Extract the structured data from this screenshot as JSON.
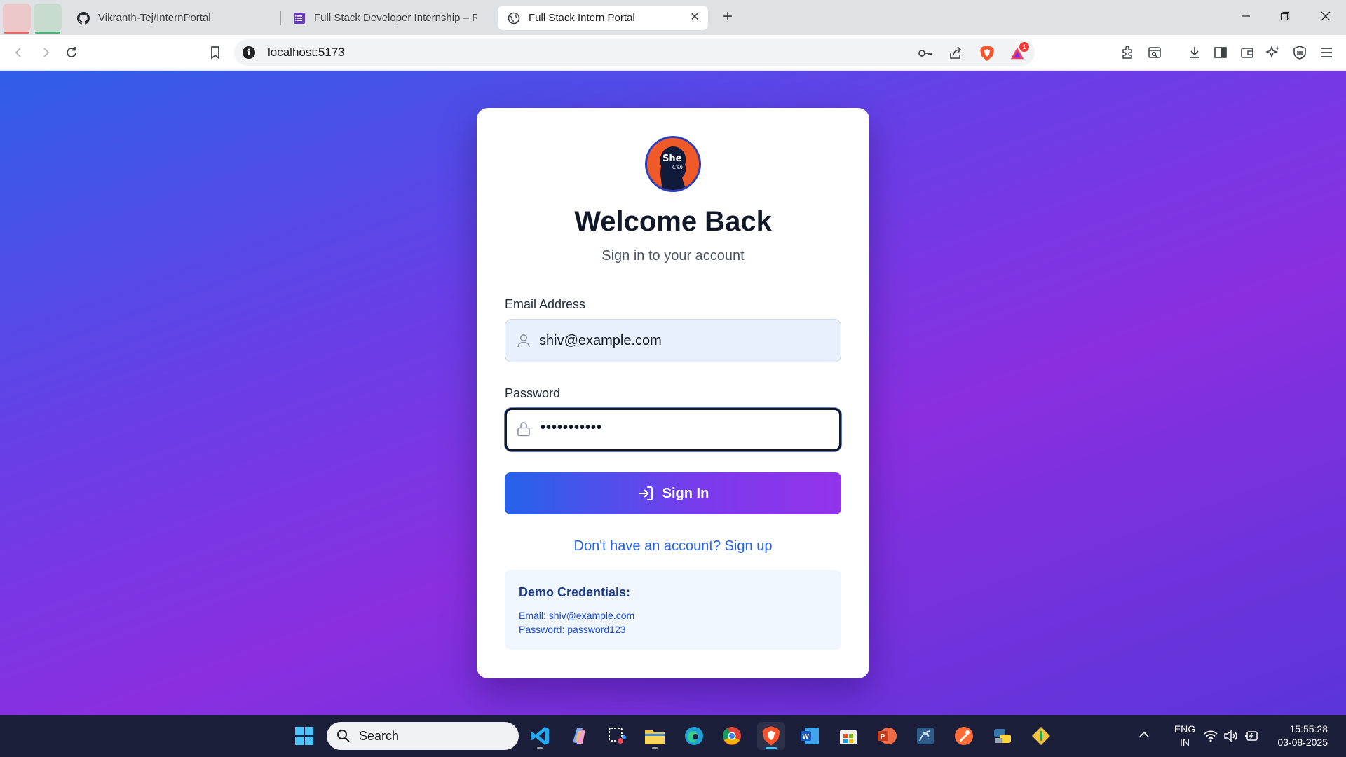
{
  "browser": {
    "tabs": [
      {
        "title": "Vikranth-Tej/InternPortal",
        "icon": "github-icon"
      },
      {
        "title": "Full Stack Developer Internship – Rou",
        "icon": "forms-icon"
      },
      {
        "title": "Full Stack Intern Portal",
        "icon": "globe-icon",
        "active": true
      }
    ],
    "new_tab": "+",
    "url": "localhost:5173",
    "notification_count": "1"
  },
  "page": {
    "logo_text": "She",
    "logo_text2": "Can",
    "heading": "Welcome Back",
    "subtitle": "Sign in to your account",
    "email_label": "Email Address",
    "email_value": "shiv@example.com",
    "password_label": "Password",
    "password_value": "•••••••••••",
    "signin_button": "Sign In",
    "signup_link": "Don't have an account? Sign up",
    "demo": {
      "title": "Demo Credentials:",
      "email_line": "Email: shiv@example.com",
      "password_line": "Password: password123"
    },
    "colors": {
      "accent_blue": "#2563eb",
      "accent_purple": "#9333ea"
    }
  },
  "taskbar": {
    "search_placeholder": "Search",
    "language": "ENG",
    "region": "IN",
    "time": "15:55:28",
    "date": "03-08-2025"
  }
}
